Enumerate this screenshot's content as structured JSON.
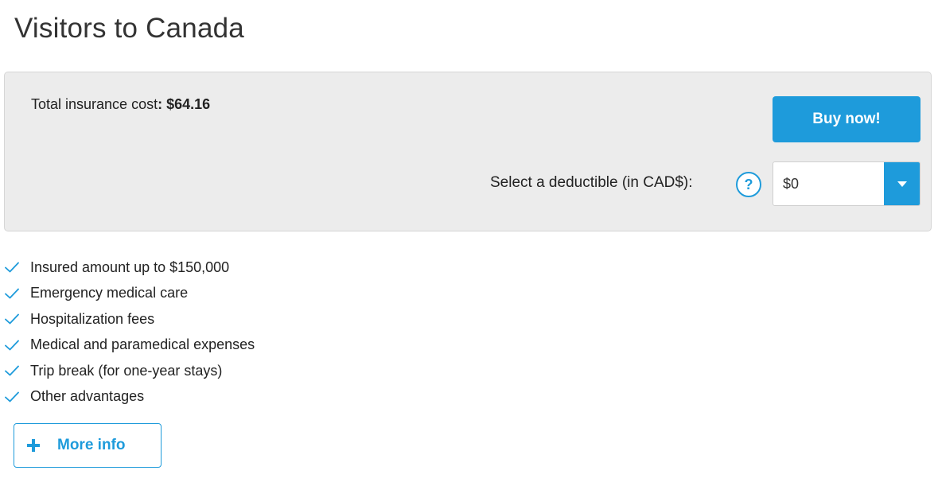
{
  "page": {
    "title": "Visitors to Canada"
  },
  "quote": {
    "total_label": "Total insurance cost",
    "total_separator": ": ",
    "total_amount": "$64.16",
    "buy_label": "Buy now!",
    "deductible_label": "Select a deductible (in CAD$):",
    "help_symbol": "?",
    "deductible_value": "$0"
  },
  "benefits": [
    "Insured amount up to $150,000",
    "Emergency medical care",
    "Hospitalization fees",
    "Medical and paramedical expenses",
    "Trip break (for one-year stays)",
    "Other advantages"
  ],
  "more_info": {
    "label": "More info"
  },
  "colors": {
    "accent": "#1e9bdb",
    "panel_bg": "#ececec",
    "text": "#222222"
  },
  "icons": {
    "benefit": "check-icon",
    "more_info": "plus-icon",
    "help": "question-circle-icon",
    "select_arrow": "chevron-down-icon"
  }
}
